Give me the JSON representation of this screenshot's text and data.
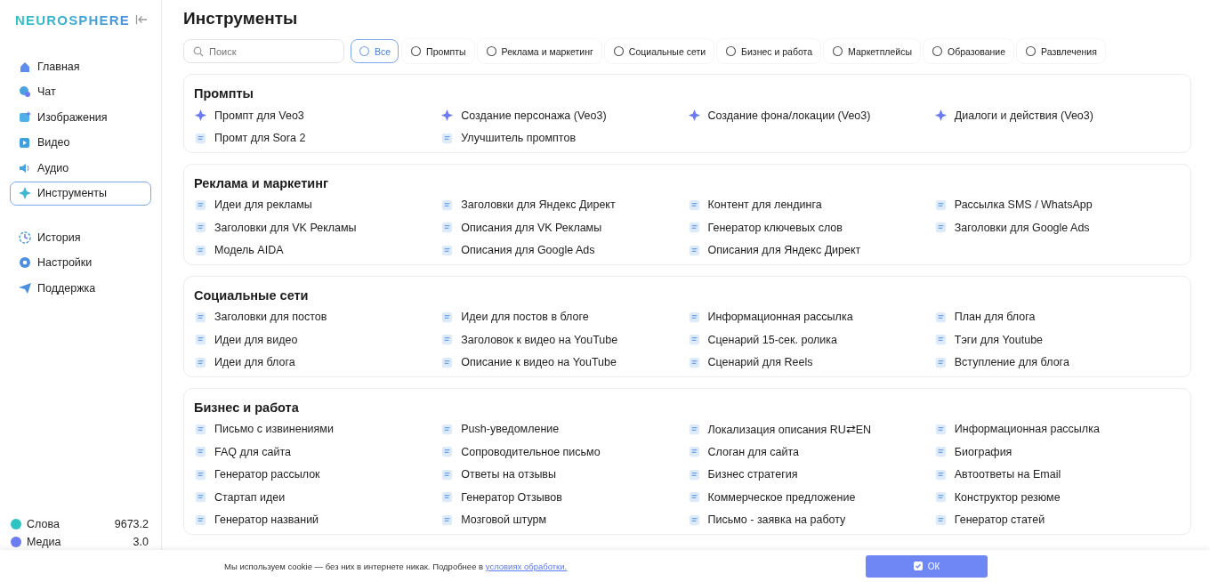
{
  "sidebar": {
    "logo": "NEUROSPHERE",
    "nav": [
      {
        "label": "Главная",
        "selected": false
      },
      {
        "label": "Чат",
        "selected": false
      },
      {
        "label": "Изображения",
        "selected": false
      },
      {
        "label": "Видео",
        "selected": false
      },
      {
        "label": "Аудио",
        "selected": false
      },
      {
        "label": "Инструменты",
        "selected": true
      }
    ],
    "nav_secondary": [
      {
        "label": "История",
        "selected": false
      },
      {
        "label": "Настройки",
        "selected": false
      },
      {
        "label": "Поддержка",
        "selected": false
      }
    ],
    "balances": [
      {
        "label": "Слова",
        "value": "9673.2",
        "color": "#2ec4c4"
      },
      {
        "label": "Медиа",
        "value": "3.0",
        "color": "#6c7cf5"
      }
    ]
  },
  "page": {
    "title": "Инструменты",
    "search": {
      "placeholder": "Поиск"
    },
    "filters": [
      {
        "label": "Все",
        "selected": true
      },
      {
        "label": "Промпты",
        "selected": false
      },
      {
        "label": "Реклама и маркетинг",
        "selected": false
      },
      {
        "label": "Социальные сети",
        "selected": false
      },
      {
        "label": "Бизнес и работа",
        "selected": false
      },
      {
        "label": "Маркетплейсы",
        "selected": false
      },
      {
        "label": "Образование",
        "selected": false
      },
      {
        "label": "Развлечения",
        "selected": false
      }
    ],
    "sections": [
      {
        "title": "Промпты",
        "items": [
          "Промпт для Veo3",
          "Создание персонажа (Veo3)",
          "Создание фона/локации (Veo3)",
          "Диалоги и действия (Veo3)",
          "Промт для Sora 2",
          "Улучшитель промптов"
        ]
      },
      {
        "title": "Реклама и маркетинг",
        "items": [
          "Идеи для рекламы",
          "Заголовки для Яндекс Директ",
          "Контент для лендинга",
          "Рассылка SMS / WhatsApp",
          "Заголовки для VK Рекламы",
          "Описания для VK Рекламы",
          "Генератор ключевых слов",
          "Заголовки для Google Ads",
          "Модель AIDA",
          "Описания для Google Ads",
          "Описания для Яндекс Директ"
        ]
      },
      {
        "title": "Социальные сети",
        "items": [
          "Заголовки для постов",
          "Идеи для постов в блоге",
          "Информационная рассылка",
          "План для блога",
          "Идеи для видео",
          "Заголовок к видео на YouTube",
          "Сценарий 15-сек. ролика",
          "Тэги для Youtube",
          "Идеи для блога",
          "Описание к видео на YouTube",
          "Сценарий для Reels",
          "Вступление для блога"
        ]
      },
      {
        "title": "Бизнес и работа",
        "items": [
          "Письмо с извинениями",
          "Push-уведомление",
          "Локализация описания RU⇄EN",
          "Информационная рассылка",
          "FAQ для сайта",
          "Сопроводительное письмо",
          "Слоган для сайта",
          "Биография",
          "Генератор рассылок",
          "Ответы на отзывы",
          "Бизнес стратегия",
          "Автоответы на Email",
          "Стартап идеи",
          "Генератор Отзывов",
          "Коммерческое предложение",
          "Конструктор резюме",
          "Генератор названий",
          "Мозговой штурм",
          "Письмо - заявка на работу",
          "Генератор статей"
        ]
      }
    ]
  },
  "cookie": {
    "text": "Мы используем cookie — без них в интернете никак. Подробнее в ",
    "link": "условиях обработки.",
    "button": "ОК"
  }
}
